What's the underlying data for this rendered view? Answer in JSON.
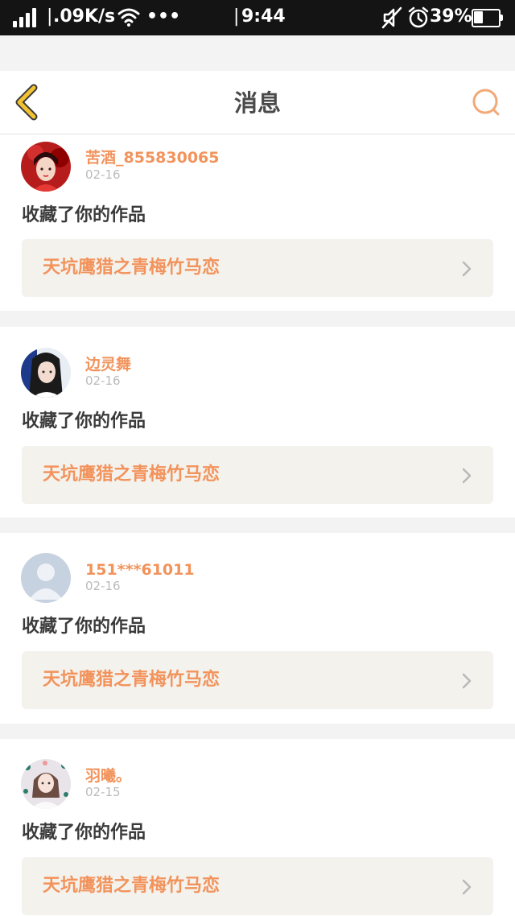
{
  "status_bar": {
    "network_speed": ".09K/s",
    "time": "9:44",
    "battery_percent_text": "39%",
    "battery_level": 0.39,
    "icons": [
      "signal-icon",
      "wifi-icon",
      "more-dots-icon",
      "mute-icon",
      "alarm-icon",
      "battery-icon"
    ]
  },
  "header": {
    "title": "消息",
    "back_icon": "chevron-left-icon",
    "search_icon": "search-icon"
  },
  "colors": {
    "accent": "#f2935c",
    "back_icon": "#f1c232",
    "text_dark": "#3b3b3b",
    "date_gray": "#bbbbbb",
    "link_bg": "#f4f2ed",
    "page_bg": "#f3f3f3"
  },
  "messages": [
    {
      "username": "苦酒_855830065",
      "date": "02-16",
      "action": "收藏了你的作品",
      "work_title": "天坑鹰猎之青梅竹马恋",
      "avatar": "red-illustration-avatar"
    },
    {
      "username": "边灵舞",
      "date": "02-16",
      "action": "收藏了你的作品",
      "work_title": "天坑鹰猎之青梅竹马恋",
      "avatar": "girl-photo-avatar"
    },
    {
      "username": "151***61011",
      "date": "02-16",
      "action": "收藏了你的作品",
      "work_title": "天坑鹰猎之青梅竹马恋",
      "avatar": "default-user-avatar"
    },
    {
      "username": "羽曦。",
      "date": "02-15",
      "action": "收藏了你的作品",
      "work_title": "天坑鹰猎之青梅竹马恋",
      "avatar": "star-frame-girl-avatar"
    }
  ]
}
